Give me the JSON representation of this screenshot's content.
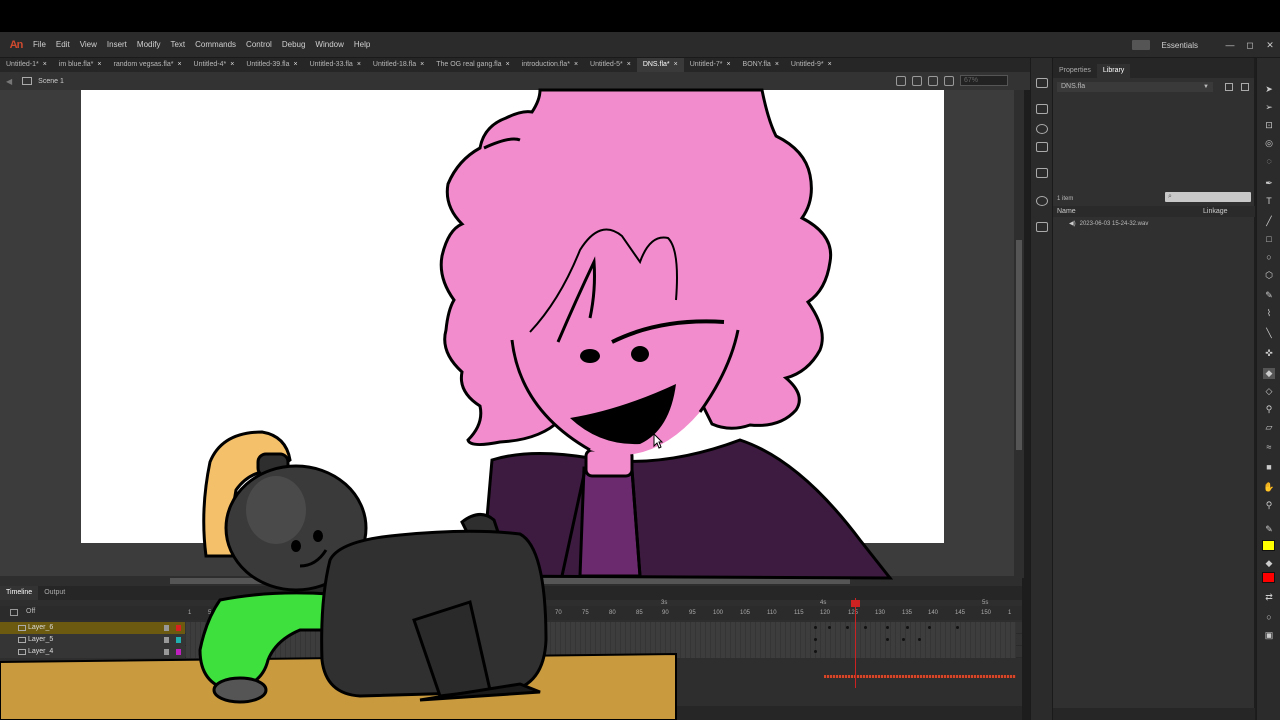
{
  "app": {
    "logo": "An"
  },
  "menu": [
    "File",
    "Edit",
    "View",
    "Insert",
    "Modify",
    "Text",
    "Commands",
    "Control",
    "Debug",
    "Window",
    "Help"
  ],
  "workspace": "Essentials",
  "window_buttons": [
    "—",
    "◻",
    "✕"
  ],
  "tabs": [
    {
      "label": "Untitled-1*"
    },
    {
      "label": "im blue.fla*"
    },
    {
      "label": "random vegsas.fla*"
    },
    {
      "label": "Untitled-4*"
    },
    {
      "label": "Untitled-39.fla"
    },
    {
      "label": "Untitled-33.fla"
    },
    {
      "label": "Untitled-18.fla"
    },
    {
      "label": "The OG real gang.fla"
    },
    {
      "label": "introduction.fla*"
    },
    {
      "label": "Untitled-5*"
    },
    {
      "label": "DNS.fla*",
      "active": true
    },
    {
      "label": "Untitled-7*"
    },
    {
      "label": "BONY.fla"
    },
    {
      "label": "Untitled-9*"
    }
  ],
  "scene": {
    "label": "Scene 1",
    "zoom": "67%"
  },
  "timeline": {
    "tabs": [
      "Timeline",
      "Output"
    ],
    "onion_label": "Off",
    "ruler": [
      "1",
      "5",
      "70",
      "75",
      "80",
      "85",
      "90",
      "95",
      "100",
      "105",
      "110",
      "115",
      "120",
      "125",
      "130",
      "135",
      "140",
      "145",
      "150",
      "1"
    ],
    "seconds": [
      "3s",
      "4s",
      "5s"
    ],
    "layers": [
      {
        "name": "Layer_6",
        "color": "#d82020",
        "selected": true
      },
      {
        "name": "Layer_5",
        "color": "#20b0b0"
      },
      {
        "name": "Layer_4",
        "color": "#c020c0"
      }
    ]
  },
  "panel": {
    "tabs": [
      "Properties",
      "Library"
    ],
    "library_select": "DNS.fla",
    "count": "1 item",
    "col_name": "Name",
    "col_linkage": "Linkage",
    "item": "2023-06-03 15-24-32.wav"
  },
  "tools": [
    "select-tool",
    "subselect-tool",
    "transform-tool",
    "3d-rotation-tool",
    "lasso-tool",
    "pen-tool",
    "text-tool",
    "line-tool",
    "rectangle-tool",
    "oval-tool",
    "polystar-tool",
    "pencil-tool",
    "brush-tool",
    "paint-brush-tool",
    "bone-tool",
    "paint-bucket-tool",
    "ink-bottle-tool",
    "eyedropper-tool",
    "eraser-tool",
    "width-tool",
    "camera-tool",
    "hand-tool",
    "zoom-tool"
  ],
  "colors": {
    "stroke": "#ffff00",
    "fill": "#ff0000",
    "accent": "#d04a2f"
  }
}
